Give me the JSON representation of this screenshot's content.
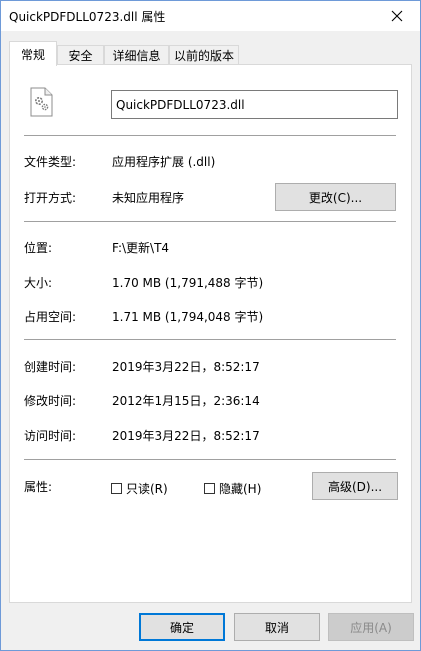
{
  "window": {
    "title": "QuickPDFDLL0723.dll 属性"
  },
  "tabs": [
    {
      "label": "常规"
    },
    {
      "label": "安全"
    },
    {
      "label": "详细信息"
    },
    {
      "label": "以前的版本"
    }
  ],
  "general": {
    "file_name": "QuickPDFDLL0723.dll",
    "file_type_label": "文件类型:",
    "file_type_value": "应用程序扩展 (.dll)",
    "open_with_label": "打开方式:",
    "open_with_value": "未知应用程序",
    "change_button": "更改(C)...",
    "location_label": "位置:",
    "location_value": "F:\\更新\\T4",
    "size_label": "大小:",
    "size_value": "1.70 MB (1,791,488 字节)",
    "size_on_disk_label": "占用空间:",
    "size_on_disk_value": "1.71 MB (1,794,048 字节)",
    "created_label": "创建时间:",
    "created_value": "2019年3月22日，8:52:17",
    "modified_label": "修改时间:",
    "modified_value": "2012年1月15日，2:36:14",
    "accessed_label": "访问时间:",
    "accessed_value": "2019年3月22日，8:52:17",
    "attributes_label": "属性:",
    "readonly_label": "只读(R)",
    "hidden_label": "隐藏(H)",
    "advanced_button": "高级(D)..."
  },
  "footer": {
    "ok": "确定",
    "cancel": "取消",
    "apply": "应用(A)"
  },
  "colors": {
    "accent": "#0078d7",
    "window_border": "#6e9ad8"
  }
}
